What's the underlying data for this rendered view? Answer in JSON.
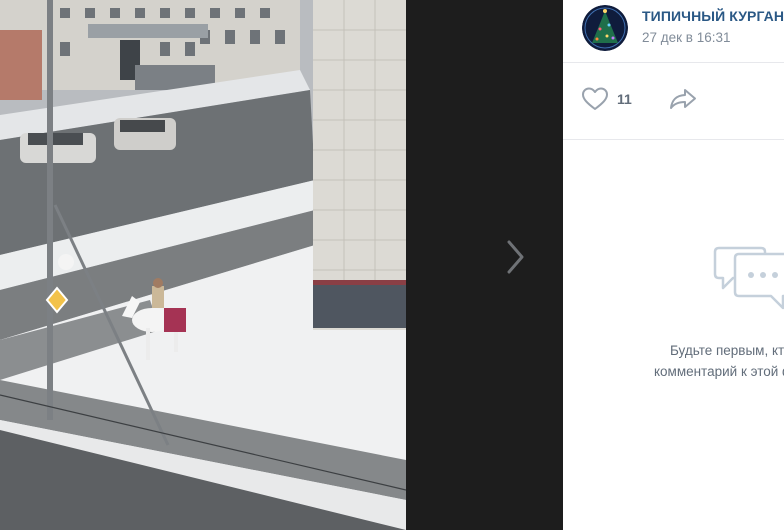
{
  "post": {
    "group_name": "ТИПИЧНЫЙ КУРГАН",
    "date": "27 дек в 16:31",
    "likes": "11"
  },
  "comments": {
    "empty_line1": "Будьте первым, кто оставит",
    "empty_line2": "комментарий к этой фотографии"
  },
  "icons": {
    "avatar": "christmas-tree-avatar",
    "like": "heart-icon",
    "share": "share-arrow-icon",
    "next": "chevron-right-icon",
    "empty": "chat-bubble-icon"
  },
  "colors": {
    "link": "#2a5885",
    "muted": "#818c99",
    "icon": "#99a2ad",
    "viewer_bg": "#1d1d1d"
  }
}
